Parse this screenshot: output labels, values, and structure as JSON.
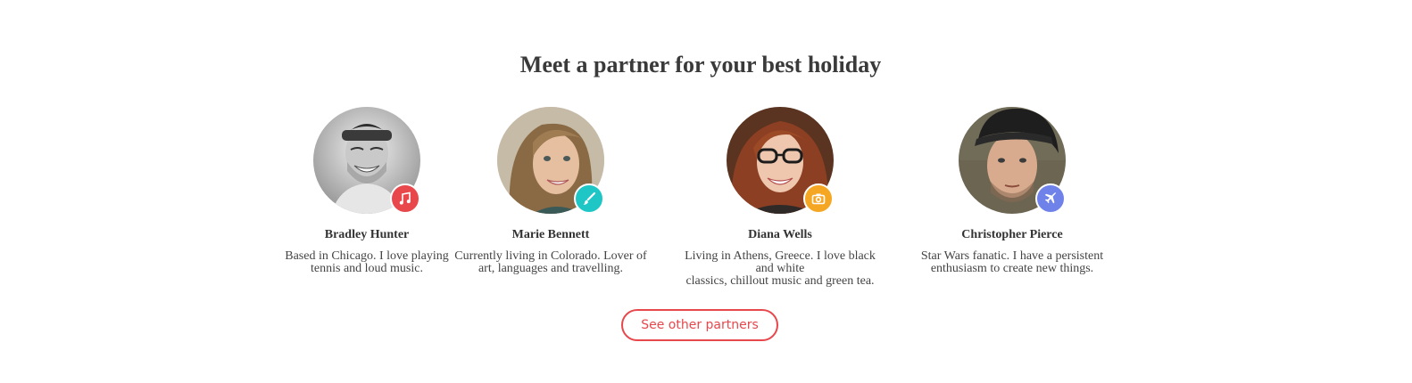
{
  "section": {
    "title": "Meet a partner for your best holiday"
  },
  "partners": [
    {
      "name": "Bradley Hunter",
      "bio_line1": "Based in Chicago. I love playing",
      "bio_line2": "tennis and loud music.",
      "badge_icon": "music-note-icon",
      "badge_color": "#e8474c"
    },
    {
      "name": "Marie Bennett",
      "bio_line1": "Currently living in Colorado. Lover of",
      "bio_line2": "art, languages and travelling.",
      "badge_icon": "paintbrush-icon",
      "badge_color": "#1fc6c6"
    },
    {
      "name": "Diana Wells",
      "bio_line1": "Living in Athens, Greece. I love black and white",
      "bio_line2": "classics, chillout music and green tea.",
      "badge_icon": "camera-icon",
      "badge_color": "#f5a623"
    },
    {
      "name": "Christopher Pierce",
      "bio_line1": "Star Wars fanatic. I have a persistent",
      "bio_line2": "enthusiasm to create new things.",
      "badge_icon": "airplane-icon",
      "badge_color": "#6f82ea"
    }
  ],
  "cta": {
    "label": "See other partners",
    "color": "#e8474c"
  }
}
